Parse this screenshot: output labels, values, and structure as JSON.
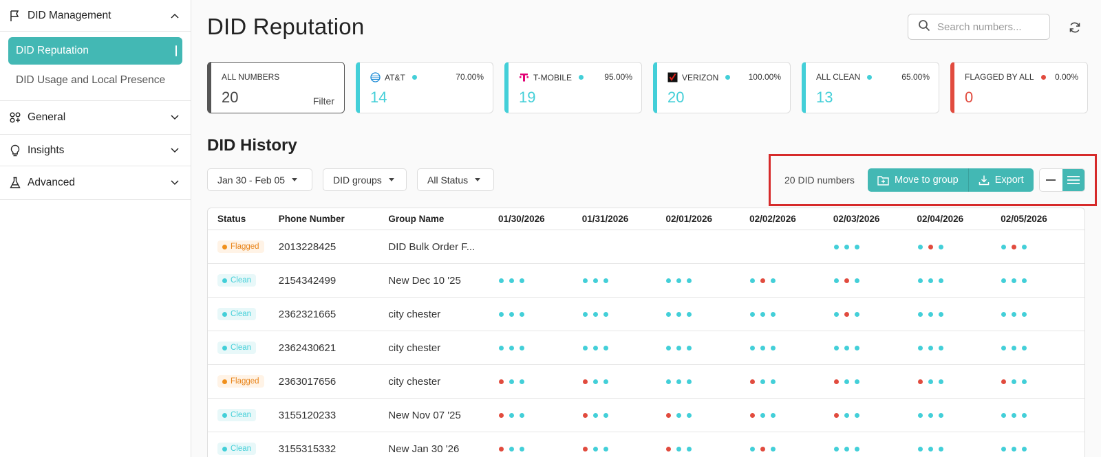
{
  "sidebar": {
    "did_management": "DID Management",
    "did_reputation": "DID Reputation",
    "did_usage": "DID Usage and Local Presence",
    "general": "General",
    "insights": "Insights",
    "advanced": "Advanced"
  },
  "header": {
    "title": "DID Reputation",
    "search_placeholder": "Search numbers..."
  },
  "cards": [
    {
      "name": "ALL NUMBERS",
      "value": "20",
      "filter": "Filter"
    },
    {
      "name": "AT&T",
      "pct": "70.00%",
      "value": "14"
    },
    {
      "name": "T-MOBILE",
      "pct": "95.00%",
      "value": "19"
    },
    {
      "name": "VERIZON",
      "pct": "100.00%",
      "value": "20"
    },
    {
      "name": "ALL CLEAN",
      "pct": "65.00%",
      "value": "13"
    },
    {
      "name": "FLAGGED BY ALL",
      "pct": "0.00%",
      "value": "0"
    }
  ],
  "history": {
    "title": "DID History",
    "date_filter": "Jan 30 - Feb 05",
    "groups_filter": "DID groups",
    "status_filter": "All Status",
    "count_label": "20 DID numbers",
    "move_label": "Move to group",
    "export_label": "Export"
  },
  "table": {
    "headers": {
      "status": "Status",
      "phone": "Phone Number",
      "group": "Group Name",
      "d1": "01/30/2026",
      "d2": "01/31/2026",
      "d3": "02/01/2026",
      "d4": "02/02/2026",
      "d5": "02/03/2026",
      "d6": "02/04/2026",
      "d7": "02/05/2026"
    },
    "rows": [
      {
        "status": "Flagged",
        "phone": "2013228425",
        "group": "DID Bulk Order F...",
        "dots": [
          "",
          "",
          "",
          "",
          "ccc",
          "crc",
          "crc"
        ]
      },
      {
        "status": "Clean",
        "phone": "2154342499",
        "group": "New Dec 10 '25",
        "dots": [
          "ccc",
          "ccc",
          "ccc",
          "crc",
          "crc",
          "ccc",
          "ccc"
        ]
      },
      {
        "status": "Clean",
        "phone": "2362321665",
        "group": "city chester",
        "dots": [
          "ccc",
          "ccc",
          "ccc",
          "ccc",
          "crc",
          "ccc",
          "ccc"
        ]
      },
      {
        "status": "Clean",
        "phone": "2362430621",
        "group": "city chester",
        "dots": [
          "ccc",
          "ccc",
          "ccc",
          "ccc",
          "ccc",
          "ccc",
          "ccc"
        ]
      },
      {
        "status": "Flagged",
        "phone": "2363017656",
        "group": "city chester",
        "dots": [
          "rcc",
          "rcc",
          "ccc",
          "rcc",
          "rcc",
          "rcc",
          "rcc"
        ]
      },
      {
        "status": "Clean",
        "phone": "3155120233",
        "group": "New Nov 07 '25",
        "dots": [
          "rcc",
          "rcc",
          "rcc",
          "rcc",
          "rcc",
          "ccc",
          "ccc"
        ]
      },
      {
        "status": "Clean",
        "phone": "3155315332",
        "group": "New Jan 30 '26",
        "dots": [
          "rcc",
          "rcc",
          "rcc",
          "crc",
          "ccc",
          "ccc",
          "ccc"
        ]
      }
    ]
  },
  "colors": {
    "accent": "#43b8b4",
    "cyan": "#43cfd8",
    "red": "#e14b3e",
    "orange": "#f0901c"
  }
}
